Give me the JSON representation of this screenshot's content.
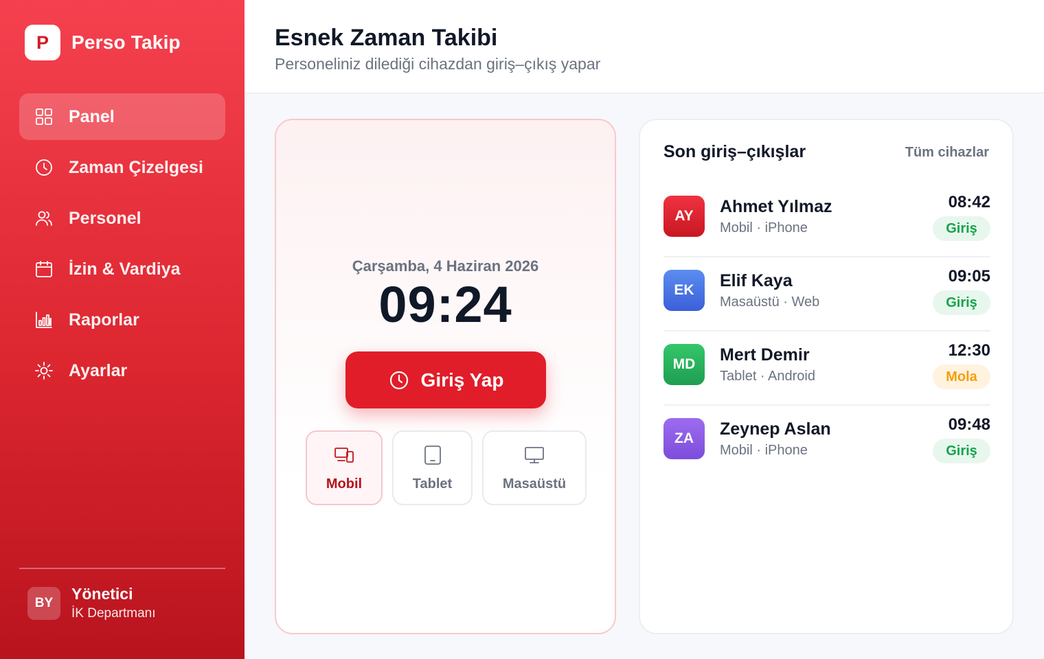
{
  "brand": {
    "logo_letter": "P",
    "name": "Perso Takip"
  },
  "nav": {
    "items": [
      {
        "label": "Panel",
        "icon": "grid-icon",
        "active": true
      },
      {
        "label": "Zaman Çizelgesi",
        "icon": "clock-icon",
        "active": false
      },
      {
        "label": "Personel",
        "icon": "users-icon",
        "active": false
      },
      {
        "label": "İzin & Vardiya",
        "icon": "calendar-icon",
        "active": false
      },
      {
        "label": "Raporlar",
        "icon": "bar-chart-icon",
        "active": false
      },
      {
        "label": "Ayarlar",
        "icon": "sun-icon",
        "active": false
      }
    ]
  },
  "user": {
    "initials": "BY",
    "name": "Yönetici",
    "department": "İK Departmanı"
  },
  "header": {
    "title": "Esnek Zaman Takibi",
    "subtitle": "Personeliniz dilediği cihazdan giriş–çıkış yapar"
  },
  "clock": {
    "date": "Çarşamba, 4 Haziran 2026",
    "time": "09:24",
    "button_label": "Giriş Yap",
    "devices": [
      {
        "label": "Mobil",
        "icon": "mobile-devices-icon",
        "active": true
      },
      {
        "label": "Tablet",
        "icon": "tablet-icon",
        "active": false
      },
      {
        "label": "Masaüstü",
        "icon": "monitor-icon",
        "active": false
      }
    ]
  },
  "activity": {
    "title": "Son giriş–çıkışlar",
    "link": "Tüm cihazlar",
    "rows": [
      {
        "initials": "AY",
        "name": "Ahmet Yılmaz",
        "device": "Mobil · iPhone",
        "time": "08:42",
        "status": "Giriş",
        "status_type": "in",
        "color_from": "#ef3340",
        "color_to": "#c81722"
      },
      {
        "initials": "EK",
        "name": "Elif Kaya",
        "device": "Masaüstü · Web",
        "time": "09:05",
        "status": "Giriş",
        "status_type": "in",
        "color_from": "#5b8def",
        "color_to": "#3b5fd9"
      },
      {
        "initials": "MD",
        "name": "Mert Demir",
        "device": "Tablet · Android",
        "time": "12:30",
        "status": "Mola",
        "status_type": "break",
        "color_from": "#34c76a",
        "color_to": "#1f9d52"
      },
      {
        "initials": "ZA",
        "name": "Zeynep Aslan",
        "device": "Mobil · iPhone",
        "time": "09:48",
        "status": "Giriş",
        "status_type": "in",
        "color_from": "#9d6cf0",
        "color_to": "#7c4ddb"
      }
    ]
  },
  "colors": {
    "accent": "#e11d2a",
    "success": "#16a34a",
    "warning": "#f59e0b"
  }
}
